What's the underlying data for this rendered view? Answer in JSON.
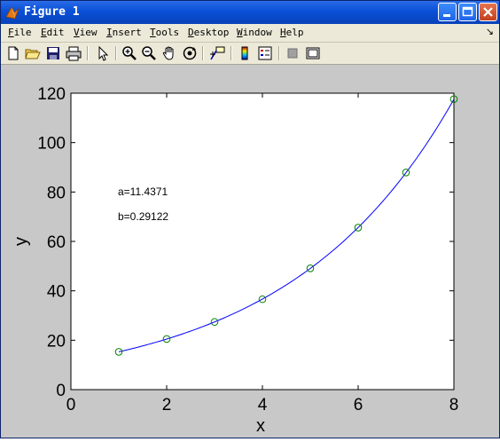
{
  "window": {
    "title": "Figure 1",
    "minimize_icon": "minimize-icon",
    "maximize_icon": "maximize-icon",
    "close_icon": "close-icon",
    "app_icon": "matlab-icon"
  },
  "menu": {
    "items": [
      {
        "mnemonic": "F",
        "rest": "ile"
      },
      {
        "mnemonic": "E",
        "rest": "dit"
      },
      {
        "mnemonic": "V",
        "rest": "iew"
      },
      {
        "mnemonic": "I",
        "rest": "nsert"
      },
      {
        "mnemonic": "T",
        "rest": "ools"
      },
      {
        "mnemonic": "D",
        "rest": "esktop"
      },
      {
        "mnemonic": "W",
        "rest": "indow"
      },
      {
        "mnemonic": "H",
        "rest": "elp"
      }
    ],
    "overflow_icon": "menu-overflow-icon"
  },
  "toolbar": {
    "icons": [
      "new-figure-icon",
      "open-file-icon",
      "save-icon",
      "print-icon",
      "edit-plot-arrow-icon",
      "zoom-in-icon",
      "zoom-out-icon",
      "pan-hand-icon",
      "rotate-3d-icon",
      "data-cursor-icon",
      "insert-colorbar-icon",
      "insert-legend-icon",
      "hide-plot-tools-icon",
      "show-plot-tools-icon"
    ]
  },
  "chart_data": {
    "type": "line",
    "xlabel": "x",
    "ylabel": "y",
    "xlim": [
      0,
      8
    ],
    "ylim": [
      0,
      120
    ],
    "xticks": [
      "0",
      "2",
      "4",
      "6",
      "8"
    ],
    "yticks": [
      "0",
      "20",
      "40",
      "60",
      "80",
      "100",
      "120"
    ],
    "series": [
      {
        "kind": "markers",
        "marker": "circle",
        "color": "#008000",
        "x": [
          1,
          2,
          3,
          4,
          5,
          6,
          7,
          8
        ],
        "y": [
          15.3,
          20.5,
          27.4,
          36.6,
          49.1,
          65.6,
          87.9,
          117.6
        ]
      },
      {
        "kind": "fit-line",
        "color": "#0000ff",
        "formula": "y = a*exp(b*x)",
        "a": 11.4371,
        "b": 0.29122,
        "x_range": [
          1,
          8
        ]
      }
    ],
    "annotations": [
      {
        "text": "a=11.4371",
        "x": 1,
        "y": 80
      },
      {
        "text": "b=0.29122",
        "x": 1,
        "y": 70
      }
    ],
    "grid": false
  }
}
